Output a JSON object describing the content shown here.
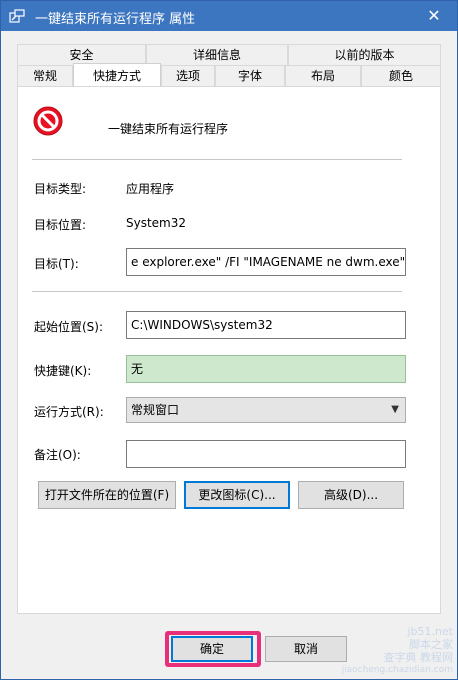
{
  "window": {
    "title": "一键结束所有运行程序 属性",
    "close_label": "✕"
  },
  "tabs": {
    "row1": [
      {
        "label": "安全"
      },
      {
        "label": "详细信息"
      },
      {
        "label": "以前的版本"
      }
    ],
    "row2": [
      {
        "label": "常规"
      },
      {
        "label": "快捷方式",
        "active": true
      },
      {
        "label": "选项"
      },
      {
        "label": "字体"
      },
      {
        "label": "布局"
      },
      {
        "label": "颜色"
      }
    ]
  },
  "shortcut": {
    "name": "一键结束所有运行程序",
    "target_type_label": "目标类型:",
    "target_type_value": "应用程序",
    "target_location_label": "目标位置:",
    "target_location_value": "System32",
    "target_label": "目标(T):",
    "target_value": "e explorer.exe\" /FI \"IMAGENAME ne dwm.exe\"",
    "start_in_label": "起始位置(S):",
    "start_in_value": "C:\\WINDOWS\\system32",
    "hotkey_label": "快捷键(K):",
    "hotkey_value": "无",
    "run_label": "运行方式(R):",
    "run_value": "常规窗口",
    "comment_label": "备注(O):",
    "comment_value": ""
  },
  "buttons": {
    "open_location": "打开文件所在的位置(F)",
    "change_icon": "更改图标(C)...",
    "advanced": "高级(D)...",
    "ok": "确定",
    "cancel": "取消"
  },
  "watermark": {
    "line1": "jb51.net",
    "line2": "脚本之家",
    "line3": "查字典 教程网",
    "line4": "jiaocheng.chazidian.com"
  },
  "colors": {
    "titlebar": "#3d76c0",
    "hotkey_field": "#cde8cd",
    "highlight": "#e8307a"
  }
}
